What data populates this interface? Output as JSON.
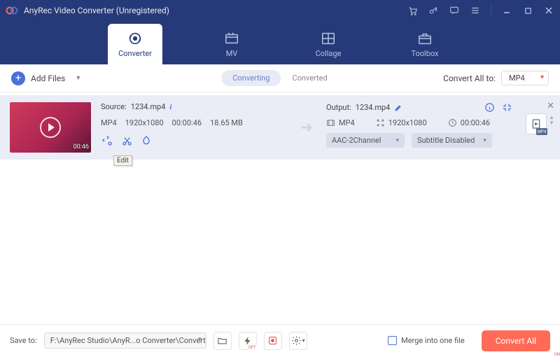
{
  "title": "AnyRec Video Converter (Unregistered)",
  "tabs": {
    "converter": "Converter",
    "mv": "MV",
    "collage": "Collage",
    "toolbox": "Toolbox"
  },
  "toolbar": {
    "add_files": "Add Files",
    "converting": "Converting",
    "converted": "Converted",
    "convert_all_to": "Convert All to:",
    "format": "MP4"
  },
  "item": {
    "source_label": "Source:",
    "source_file": "1234.mp4",
    "src_format": "MP4",
    "src_res": "1920x1080",
    "src_dur": "00:00:46",
    "src_size": "18.65 MB",
    "thumb_dur": "00:46",
    "edit_tooltip": "Edit",
    "output_label": "Output:",
    "output_file": "1234.mp4",
    "out_format": "MP4",
    "out_res": "1920x1080",
    "out_dur": "00:00:46",
    "audio_sel": "AAC-2Channel",
    "subtitle_sel": "Subtitle Disabled",
    "format_badge": "MP4"
  },
  "footer": {
    "save_to": "Save to:",
    "path": "F:\\AnyRec Studio\\AnyR...o Converter\\Converted",
    "accel_state": "OFF",
    "rec_state": "ON",
    "merge": "Merge into one file",
    "convert_all": "Convert All"
  }
}
